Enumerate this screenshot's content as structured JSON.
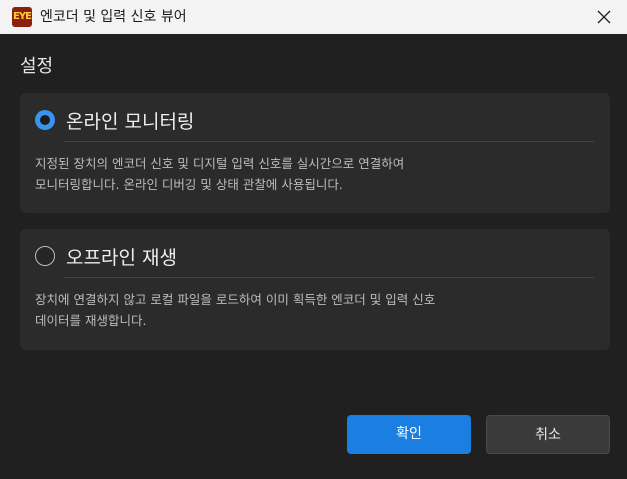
{
  "window": {
    "title": "엔코더 및 입력 신호 뷰어",
    "icon_name": "app-logo-icon",
    "icon_glyph": "EYE"
  },
  "section_title": "설정",
  "options": {
    "online": {
      "label": "온라인 모니터링",
      "selected": true,
      "description": "지정된 장치의 엔코더 신호 및 디지털 입력 신호를 실시간으로 연결하여\n모니터링합니다. 온라인 디버깅 및 상태 관찰에 사용됩니다."
    },
    "offline": {
      "label": "오프라인 재생",
      "selected": false,
      "description": "장치에 연결하지 않고 로컬 파일을 로드하여 이미 획득한 엔코더 및 입력 신호\n데이터를 재생합니다."
    }
  },
  "buttons": {
    "confirm": "확인",
    "cancel": "취소"
  },
  "colors": {
    "accent": "#1a7fe0",
    "radio_checked": "#3a93ef",
    "background": "#202020",
    "card": "#2b2b2b"
  }
}
